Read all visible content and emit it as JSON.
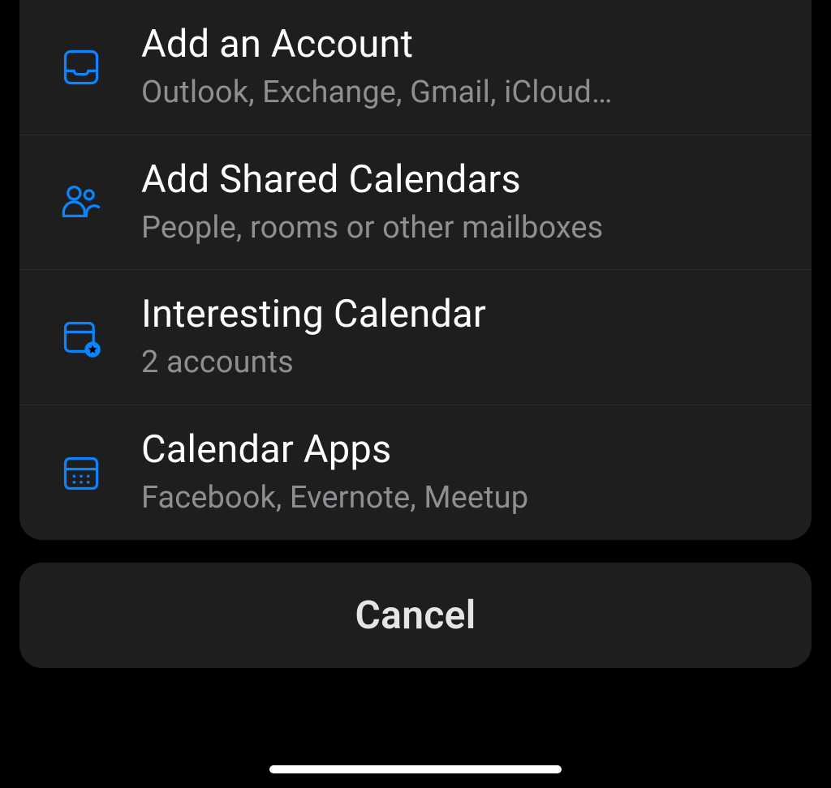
{
  "menu": {
    "items": [
      {
        "title": "Add an Account",
        "subtitle": "Outlook, Exchange, Gmail, iCloud…",
        "icon": "inbox-icon"
      },
      {
        "title": "Add Shared Calendars",
        "subtitle": "People, rooms or other mailboxes",
        "icon": "people-icon"
      },
      {
        "title": "Interesting Calendar",
        "subtitle": "2 accounts",
        "icon": "calendar-star-icon"
      },
      {
        "title": "Calendar Apps",
        "subtitle": "Facebook, Evernote, Meetup",
        "icon": "calendar-grid-icon"
      }
    ]
  },
  "cancel_label": "Cancel",
  "accent_color": "#0a84ff"
}
